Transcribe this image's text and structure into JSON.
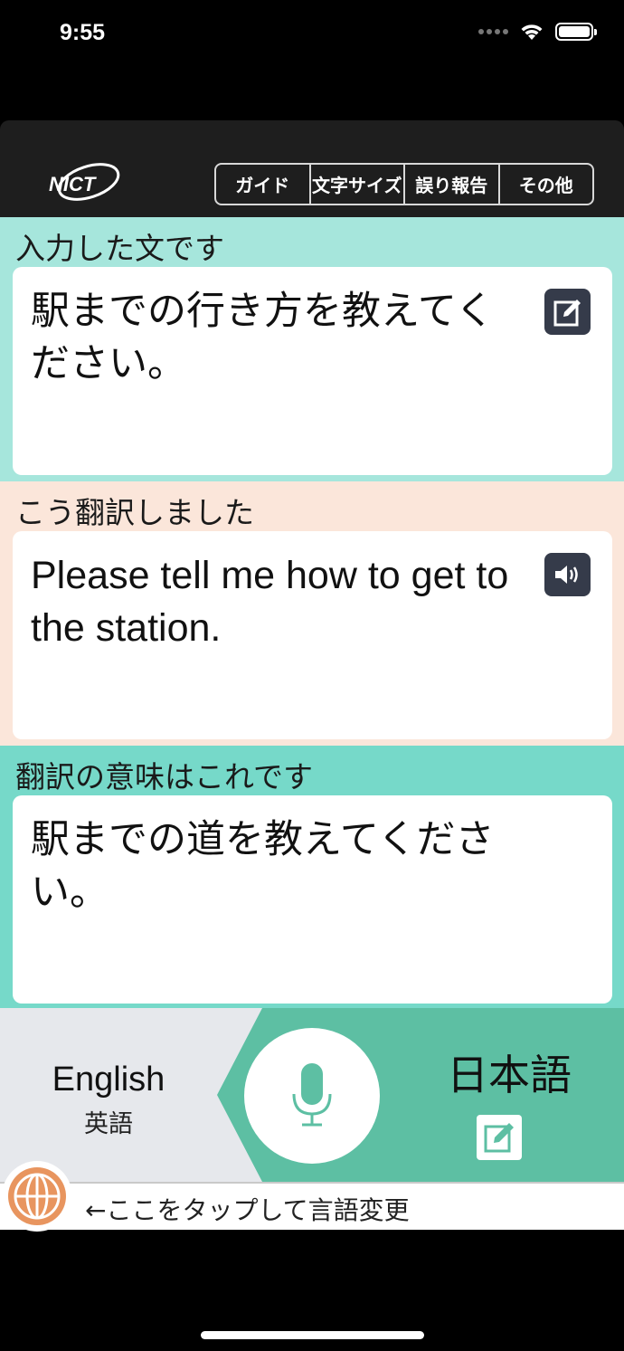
{
  "status_bar": {
    "time": "9:55"
  },
  "header": {
    "logo_text": "NICT",
    "menu": [
      {
        "label": "ガイド"
      },
      {
        "label": "文字サイズ"
      },
      {
        "label": "誤り報告"
      },
      {
        "label": "その他"
      }
    ]
  },
  "input_section": {
    "label": "入力した文です",
    "text": "駅までの行き方を教えてください。"
  },
  "translation_section": {
    "label": "こう翻訳しました",
    "text": "Please tell me how to get to the station."
  },
  "back_translation_section": {
    "label": "翻訳の意味はこれです",
    "text": "駅までの道を教えてください。"
  },
  "language_bar": {
    "left_language": "English",
    "left_language_sub": "英語",
    "right_language": "日本語"
  },
  "hint": {
    "text": "←ここをタップして言語変更"
  },
  "colors": {
    "input_bg": "#a6e6dc",
    "translation_bg": "#fbe6da",
    "back_translation_bg": "#76d9c9",
    "accent_green": "#5dbfa3",
    "icon_button": "#353b4a",
    "globe": "#e8955f"
  }
}
